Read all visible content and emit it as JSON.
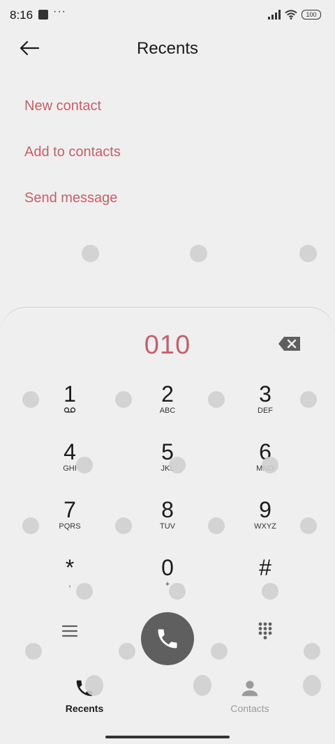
{
  "status_bar": {
    "time": "8:16",
    "dots": "···",
    "battery": "100"
  },
  "header": {
    "title": "Recents",
    "back_icon": "arrow-left-icon"
  },
  "actions": [
    {
      "label": "New contact"
    },
    {
      "label": "Add to contacts"
    },
    {
      "label": "Send message"
    }
  ],
  "dialer": {
    "number": "010",
    "keys": [
      {
        "digit": "1",
        "letters": ""
      },
      {
        "digit": "2",
        "letters": "ABC"
      },
      {
        "digit": "3",
        "letters": "DEF"
      },
      {
        "digit": "4",
        "letters": "GHI"
      },
      {
        "digit": "5",
        "letters": "JKL"
      },
      {
        "digit": "6",
        "letters": "MNO"
      },
      {
        "digit": "7",
        "letters": "PQRS"
      },
      {
        "digit": "8",
        "letters": "TUV"
      },
      {
        "digit": "9",
        "letters": "WXYZ"
      },
      {
        "digit": "*",
        "letters": ","
      },
      {
        "digit": "0",
        "letters": "+"
      },
      {
        "digit": "#",
        "letters": ""
      }
    ]
  },
  "nav": {
    "recents": "Recents",
    "contacts": "Contacts"
  },
  "colors": {
    "accent": "#c0626b",
    "call_button": "#5f5f5f",
    "background": "#efefef"
  }
}
